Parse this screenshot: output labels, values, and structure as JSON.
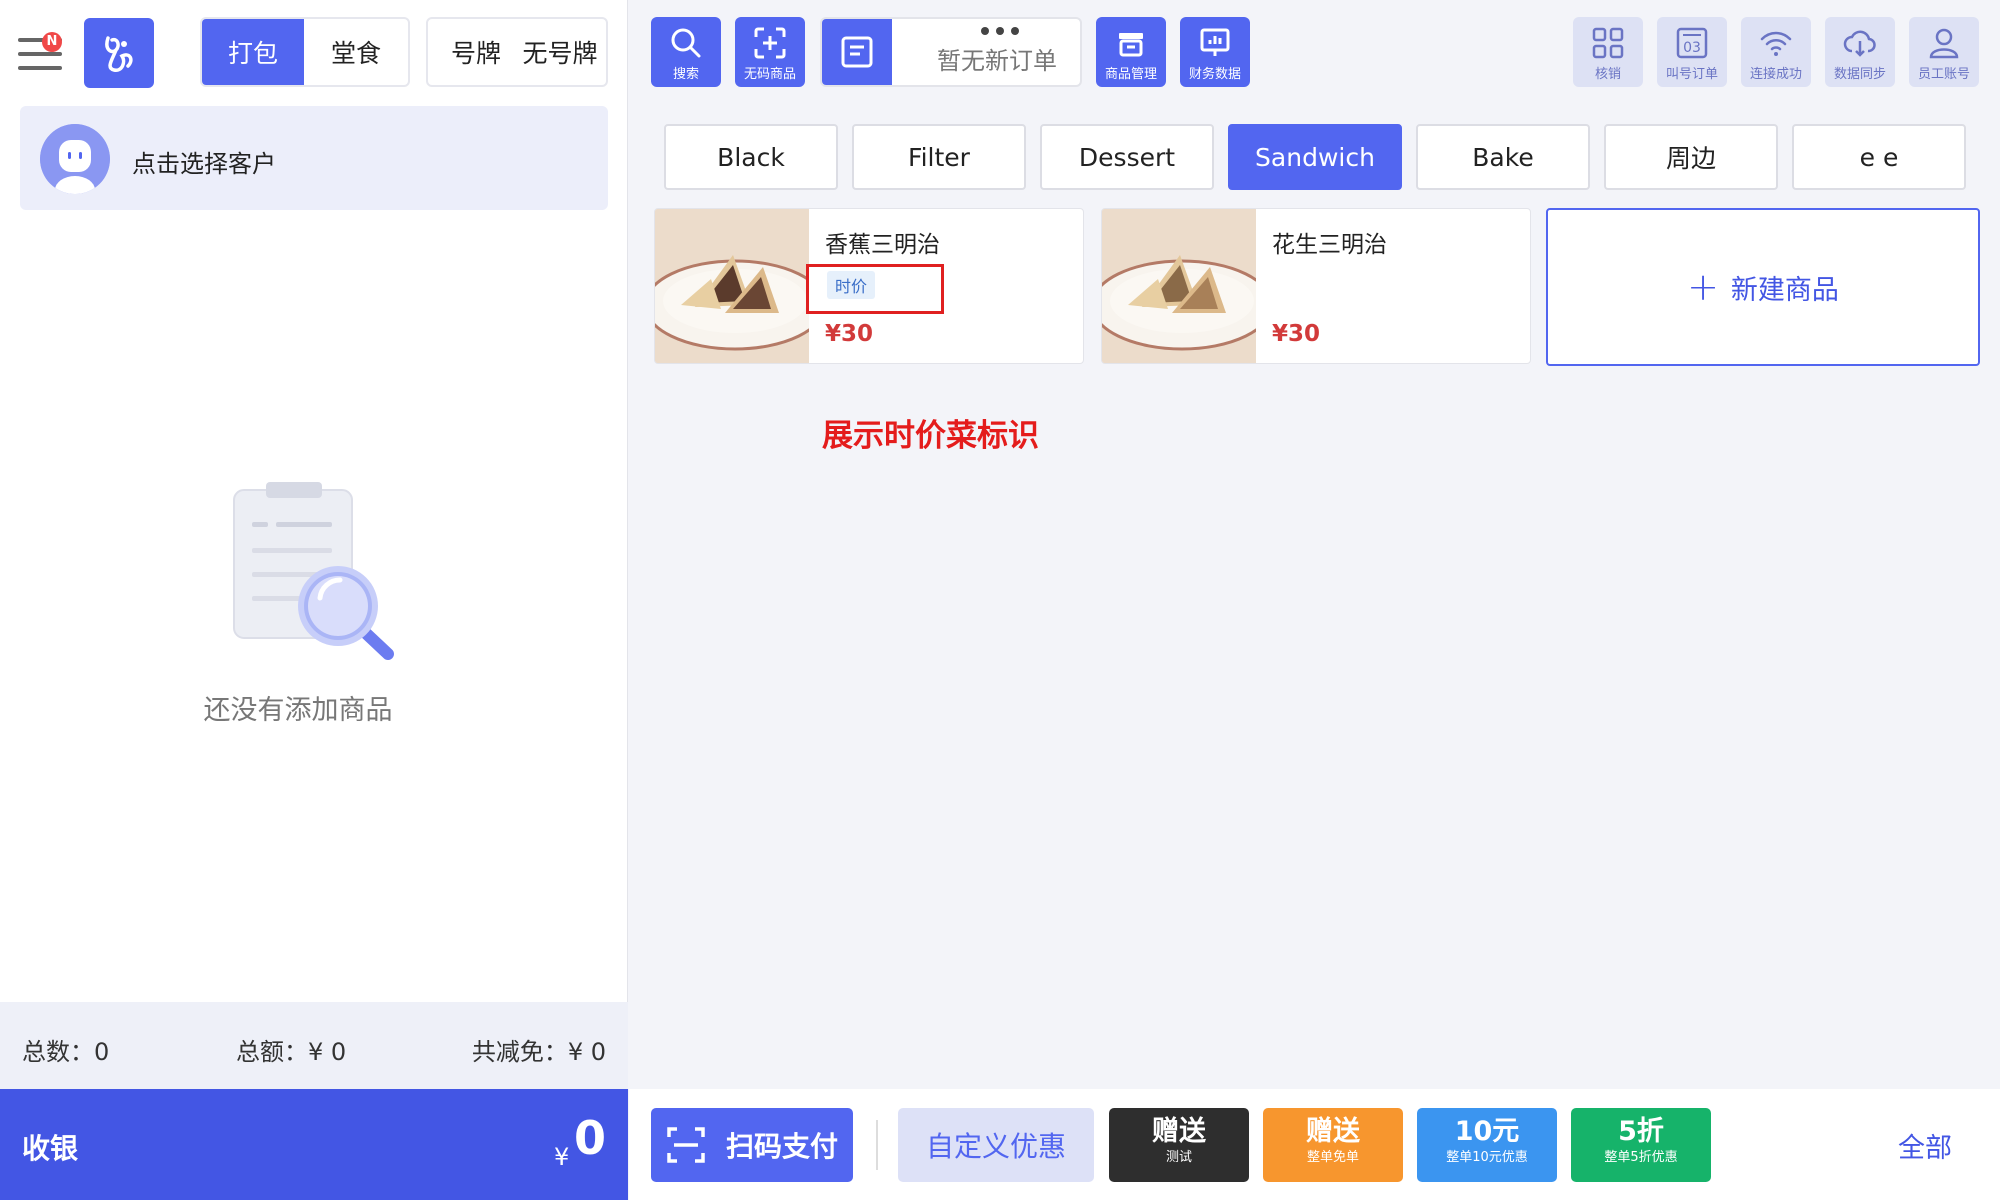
{
  "header": {
    "menu_badge": "N",
    "order_type": [
      "打包",
      "堂食"
    ],
    "table_tag": [
      "号牌",
      "无号牌"
    ]
  },
  "customer": {
    "label": "点击选择客户"
  },
  "cart": {
    "empty_text": "还没有添加商品",
    "total_count": "总数：0",
    "total_amount": "总额：¥ 0",
    "total_discount": "共减免：¥ 0"
  },
  "checkout": {
    "label": "收银",
    "currency": "¥",
    "amount": "0"
  },
  "toolbar": {
    "search": "搜索",
    "no_code_item": "无码商品",
    "new_order_status": "暂无新订单",
    "product_management": "商品管理",
    "finance_data": "财务数据",
    "verify": "核销",
    "call_number": "叫号订单",
    "call_number_icon_text": "03",
    "connection": "连接成功",
    "data_sync": "数据同步",
    "staff_account": "员工账号"
  },
  "categories": [
    "Black",
    "Filter",
    "Dessert",
    "Sandwich",
    "Bake",
    "周边",
    "e e"
  ],
  "active_category": "Sandwich",
  "products": [
    {
      "name": "香蕉三明治",
      "tag": "时价",
      "price": "¥30"
    },
    {
      "name": "花生三明治",
      "tag": "",
      "price": "¥30"
    }
  ],
  "new_product": {
    "label": "新建商品"
  },
  "annotation": {
    "text": "展示时价菜标识"
  },
  "bottom": {
    "scan_pay": "扫码支付",
    "custom_discount": "自定义优惠",
    "discounts": [
      {
        "title": "赠送",
        "subtitle": "测试",
        "color": "#2e2e2e"
      },
      {
        "title": "赠送",
        "subtitle": "整单免单",
        "color": "#f7962e"
      },
      {
        "title": "10元",
        "subtitle": "整单10元优惠",
        "color": "#3b95f0"
      },
      {
        "title": "5折",
        "subtitle": "整单5折优惠",
        "color": "#16b36a"
      }
    ],
    "all": "全部"
  },
  "colors": {
    "primary": "#5266f0",
    "primary_dark": "#4356e4",
    "highlight": "#e02020",
    "price": "#d23a3a"
  }
}
